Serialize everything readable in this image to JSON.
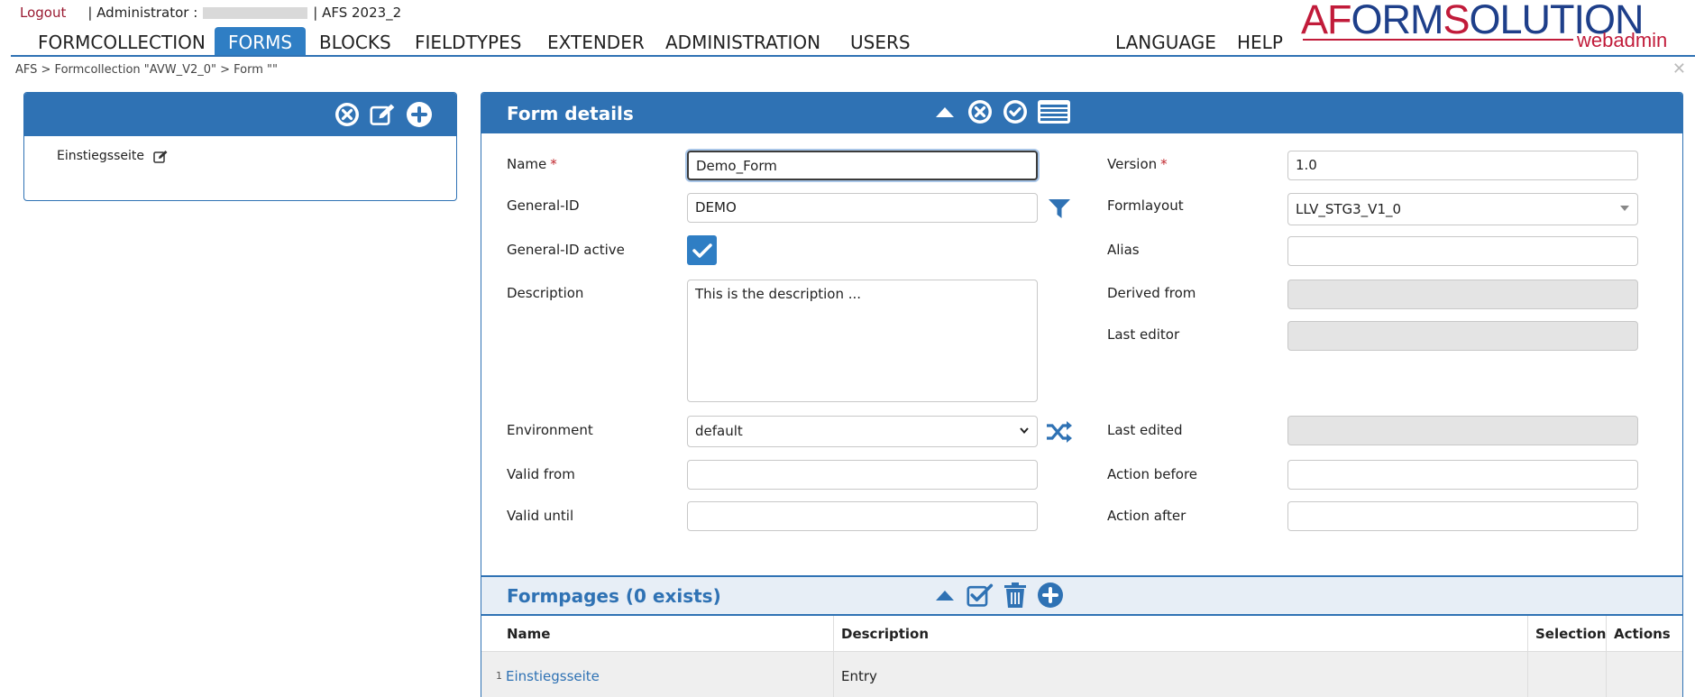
{
  "topbar": {
    "logout": "Logout",
    "admin_label": "| Administrator :",
    "version": "| AFS 2023_2"
  },
  "logo": {
    "part1": "AF",
    "part2": "ORM",
    "part3": "S",
    "part4": "OLUTION",
    "sub": "webadmin"
  },
  "nav": {
    "items": [
      "FORMCOLLECTION",
      "FORMS",
      "BLOCKS",
      "FIELDTYPES",
      "EXTENDER",
      "ADMINISTRATION",
      "USERS",
      "LANGUAGE",
      "HELP"
    ],
    "active": "FORMS"
  },
  "breadcrumb": "AFS > Formcollection \"AVW_V2_0\" > Form \"\"",
  "tree": {
    "items": [
      {
        "label": "Einstiegsseite"
      }
    ]
  },
  "form_details": {
    "title": "Form details",
    "fields": {
      "name": {
        "label": "Name",
        "value": "Demo_Form",
        "required": "*"
      },
      "general_id": {
        "label": "General-ID",
        "value": "DEMO"
      },
      "general_id_active": {
        "label": "General-ID active",
        "checked": true
      },
      "description": {
        "label": "Description",
        "value": "This is the description ..."
      },
      "environment": {
        "label": "Environment",
        "value": "default"
      },
      "valid_from": {
        "label": "Valid from",
        "value": ""
      },
      "valid_until": {
        "label": "Valid until",
        "value": ""
      },
      "version": {
        "label": "Version",
        "value": "1.0",
        "required": "*"
      },
      "formlayout": {
        "label": "Formlayout",
        "value": "LLV_STG3_V1_0"
      },
      "alias": {
        "label": "Alias",
        "value": ""
      },
      "derived_from": {
        "label": "Derived from",
        "value": ""
      },
      "last_editor": {
        "label": "Last editor",
        "value": ""
      },
      "last_edited": {
        "label": "Last edited",
        "value": ""
      },
      "action_before": {
        "label": "Action before",
        "value": ""
      },
      "action_after": {
        "label": "Action after",
        "value": ""
      }
    }
  },
  "formpages": {
    "title": "Formpages (0 exists)",
    "columns": [
      "Name",
      "Description",
      "Selection",
      "Actions"
    ],
    "rows": [
      {
        "num": "1",
        "name": "Einstiegsseite",
        "description": "Entry"
      }
    ]
  },
  "colors": {
    "primary": "#2f72b4",
    "active_tab": "#2f7ec4",
    "brand_red": "#c11b3a",
    "brand_blue": "#1e3f8a"
  }
}
